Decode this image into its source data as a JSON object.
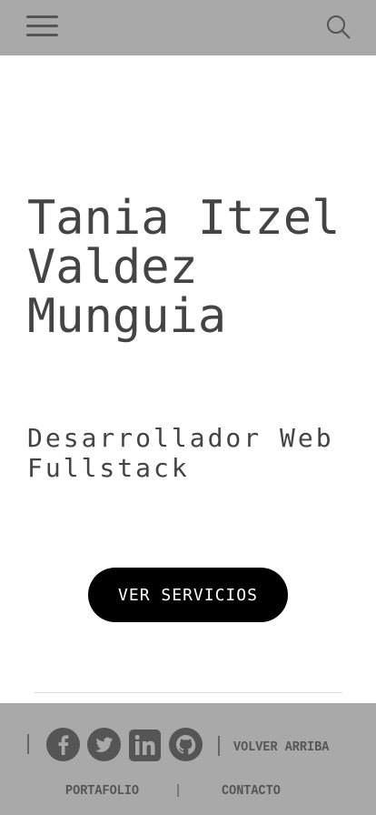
{
  "header": {
    "menu_icon": "hamburger-icon",
    "search_icon": "search-icon"
  },
  "hero": {
    "name": "Tania Itzel\nValdez\nMunguia",
    "subtitle": "Desarrollador Web\nFullstack",
    "cta_label": "VER SERVICIOS"
  },
  "footer": {
    "social": [
      "facebook-icon",
      "twitter-icon",
      "linkedin-icon",
      "github-icon"
    ],
    "back_to_top": "VOLVER ARRIBA",
    "links": [
      "PORTAFOLIO",
      "CONTACTO"
    ],
    "separator": "|"
  },
  "colors": {
    "bar": "#a9a9a9",
    "text": "#444444",
    "button": "#000000"
  }
}
